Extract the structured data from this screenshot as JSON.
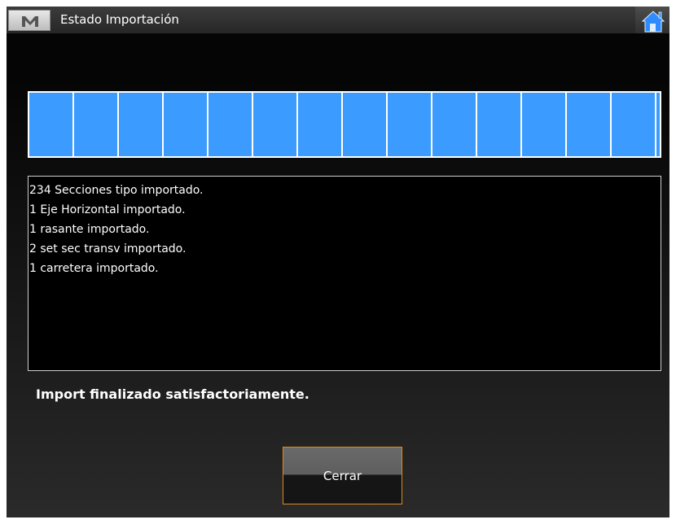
{
  "titlebar": {
    "title": "Estado Importación",
    "menu_icon": "M",
    "home_icon": "home-icon"
  },
  "progress": {
    "value": 1.0
  },
  "log": {
    "lines": [
      "234 Secciones tipo importado.",
      "1 Eje Horizontal importado.",
      "1 rasante importado.",
      "2 set sec transv importado.",
      "1 carretera importado."
    ]
  },
  "status": {
    "message": "Import finalizado satisfactoriamente."
  },
  "buttons": {
    "close_label": "Cerrar"
  },
  "colors": {
    "progress_fill": "#3b9bff",
    "button_border": "#e08a1e"
  }
}
